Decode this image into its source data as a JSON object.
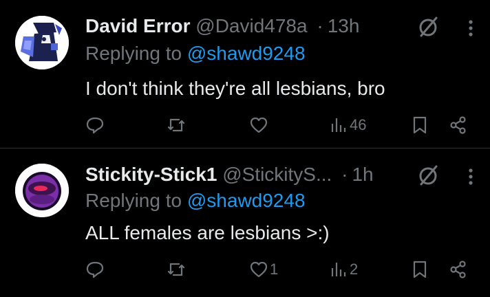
{
  "posts": [
    {
      "name": "David Error",
      "handle": "@David478a",
      "separator": "·",
      "time": "13h",
      "replying_prefix": "Replying to",
      "replying_handle": "@shawd9248",
      "text": "I don't think they're all lesbians, bro",
      "counts": {
        "reply": "",
        "repost": "",
        "like": "",
        "views": "46"
      },
      "avatar": "blue-character-avatar"
    },
    {
      "name": "Stickity-Stick1",
      "handle": "@StickityS...",
      "separator": "·",
      "time": "1h",
      "replying_prefix": "Replying to",
      "replying_handle": "@shawd9248",
      "text": "ALL females are lesbians >:)",
      "counts": {
        "reply": "",
        "repost": "",
        "like": "1",
        "views": "2"
      },
      "avatar": "purple-ring-avatar"
    }
  ],
  "colors": {
    "background": "#000000",
    "text": "#e7e9ea",
    "muted": "#71767b",
    "link": "#1d9bf0",
    "divider": "#2f3336"
  },
  "icons": [
    "reply-icon",
    "repost-icon",
    "like-icon",
    "views-icon",
    "bookmark-icon",
    "share-icon",
    "grok-icon",
    "more-icon"
  ]
}
